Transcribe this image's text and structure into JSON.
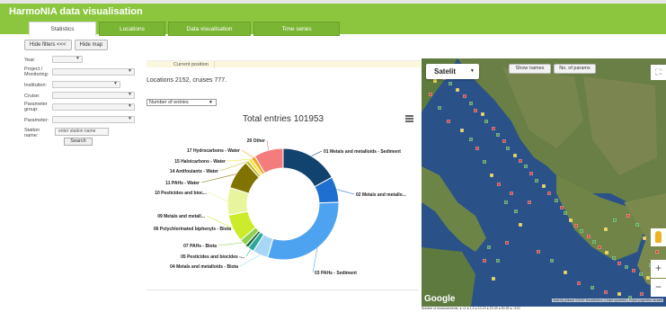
{
  "app": {
    "title": "HarmoNIA data visualisation"
  },
  "tabs": [
    {
      "label": "Statistics",
      "active": true
    },
    {
      "label": "Locations",
      "active": false
    },
    {
      "label": "Data visualisation",
      "active": false
    },
    {
      "label": "Time series",
      "active": false
    }
  ],
  "toolbar": {
    "hide_filters": "Hide filters <<<",
    "hide_map": "Hide map"
  },
  "filters": {
    "year_label": "Year:",
    "project_label": "Project / Monitoring:",
    "institution_label": "Institution:",
    "cruise_label": "Cruise:",
    "parameter_group_label": "Parameter group:",
    "parameter_label": "Parameter:",
    "station_label": "Station name:",
    "station_placeholder": "enter station name",
    "search_label": "Search"
  },
  "current_position": {
    "label": "Current position"
  },
  "summary": "Locations 2152, cruises 777.",
  "metric_select": {
    "value": "Number of entries"
  },
  "chart_data": {
    "type": "pie",
    "title": "Total entries 101953",
    "total": 101953,
    "slices": [
      {
        "label": "01 Metals and metalloids - Sediment",
        "value": 17.0,
        "color": "#12426e"
      },
      {
        "label": "02 Metals and metallo...",
        "value": 7.5,
        "color": "#1e6fcf"
      },
      {
        "label": "03 PAHs - Sediment",
        "value": 30.0,
        "color": "#4ea3f0"
      },
      {
        "label": "04 Metals and metalloids - Biota",
        "value": 4.5,
        "color": "#a8d7f5"
      },
      {
        "label": "05 Pesticides and biocides -...",
        "value": 1.8,
        "color": "#2aa89a"
      },
      {
        "label": "06 Polychlorinated biphenyls - Biota",
        "value": 1.0,
        "color": "#1f6b3a"
      },
      {
        "label": "07 PAHs - Biota",
        "value": 2.0,
        "color": "#8fd14f"
      },
      {
        "label": "09 Metals and metall...",
        "value": 8.0,
        "color": "#cceb2a"
      },
      {
        "label": "10 Pesticides and bioc...",
        "value": 8.0,
        "color": "#e8f59c"
      },
      {
        "label": "11 PAHs - Water",
        "value": 8.5,
        "color": "#807300"
      },
      {
        "label": "14 Antifoulants - Water",
        "value": 1.0,
        "color": "#c7bf33"
      },
      {
        "label": "15 Haloicarbons - Water",
        "value": 1.0,
        "color": "#f2e33b"
      },
      {
        "label": "17 Hydrocarbons - Water",
        "value": 1.2,
        "color": "#f4a522"
      },
      {
        "label": "20 Other",
        "value": 8.5,
        "color": "#f47c7c"
      }
    ]
  },
  "map": {
    "type_label": "Satelit",
    "show_names": "Show names",
    "num_params": "No. of params",
    "zoom_in": "+",
    "zoom_out": "−",
    "fullscreen": "⛶",
    "google": "Google",
    "attribution": "Sadržaj prikaza ©2020 TerraMetrics | Uvjeti upotrebe | Prijavi pogrešku na karti",
    "legend": "Number of measurements: ● <1 ● 1-9 ● 10-19 ● 20-49 ● 50-99 ● >100",
    "water_color": "#2a5289",
    "land_color": "#6a7f45"
  }
}
